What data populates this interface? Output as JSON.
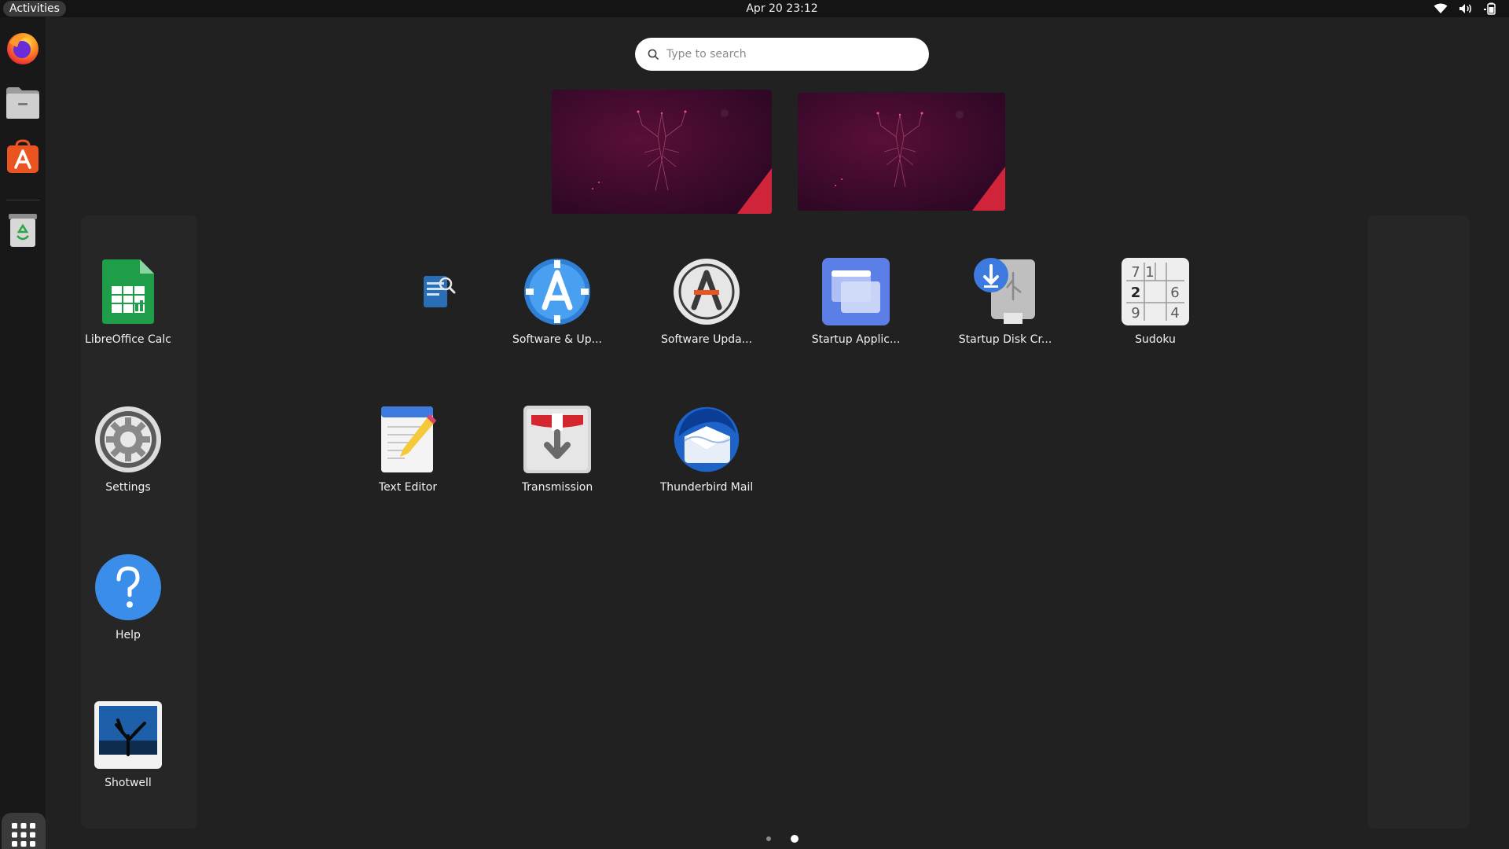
{
  "topbar": {
    "activities": "Activities",
    "clock": "Apr 20  23:12"
  },
  "dock": {
    "items": [
      {
        "name": "firefox"
      },
      {
        "name": "files"
      },
      {
        "name": "software"
      },
      {
        "name": "trash"
      }
    ]
  },
  "search": {
    "placeholder": "Type to search"
  },
  "apps": [
    {
      "label": "LibreOffice Calc"
    },
    {
      "label": ""
    },
    {
      "label": "Software & Up..."
    },
    {
      "label": "Software Upda..."
    },
    {
      "label": "Startup Applic..."
    },
    {
      "label": "Startup Disk Cr..."
    },
    {
      "label": "Sudoku"
    },
    {
      "label": "Settings"
    },
    {
      "label": "Text Editor"
    },
    {
      "label": "Transmission"
    },
    {
      "label": "Thunderbird Mail"
    },
    {
      "label": "Help"
    },
    {
      "label": "Shotwell"
    }
  ],
  "sudoku_digits": [
    "7",
    "1",
    "2",
    "6",
    "9",
    "4"
  ],
  "colors": {
    "background": "#212121",
    "topbar": "#141414",
    "dock": "#181818",
    "calc_green": "#1f9e4a",
    "ubuntu_orange": "#e95420"
  }
}
